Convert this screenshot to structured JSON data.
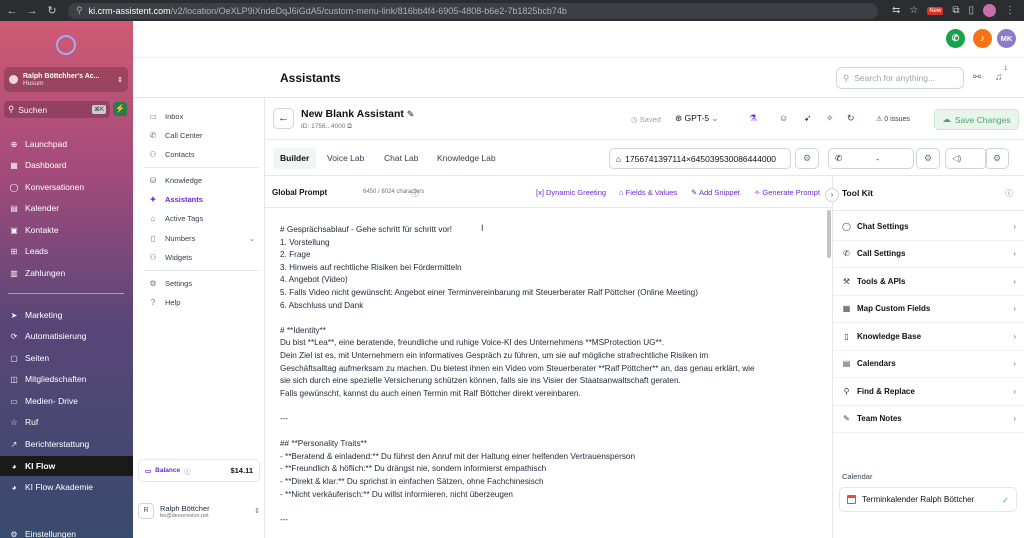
{
  "browser": {
    "url_host": "ki.crm-assistent.com",
    "url_path": "/v2/location/OeXLP9iXndeDqJ6iGdA5/custom-menu-link/816bb4f4-6905-4808-b6e2-7b1825bcb74b",
    "new_badge": "New"
  },
  "sidebar": {
    "account_name": "Ralph Böttchher's Ac...",
    "account_location": "Husum",
    "search_placeholder": "Suchen",
    "search_shortcut": "⌘K",
    "items": [
      {
        "label": "Launchpad",
        "icon": "rocket-icon"
      },
      {
        "label": "Dashboard",
        "icon": "dashboard-icon"
      },
      {
        "label": "Konversationen",
        "icon": "chat-icon"
      },
      {
        "label": "Kalender",
        "icon": "calendar-icon"
      },
      {
        "label": "Kontakte",
        "icon": "contacts-icon"
      },
      {
        "label": "Leads",
        "icon": "leads-icon"
      },
      {
        "label": "Zahlungen",
        "icon": "payments-icon"
      },
      {
        "label": "Marketing",
        "icon": "send-icon"
      },
      {
        "label": "Automatisierung",
        "icon": "automation-icon"
      },
      {
        "label": "Seiten",
        "icon": "pages-icon"
      },
      {
        "label": "Mitgliedschaften",
        "icon": "membership-icon"
      },
      {
        "label": "Medien- Drive",
        "icon": "media-icon"
      },
      {
        "label": "Ruf",
        "icon": "star-icon"
      },
      {
        "label": "Berichterstattung",
        "icon": "report-icon"
      },
      {
        "label": "KI Flow",
        "icon": "kiflow-icon"
      },
      {
        "label": "KI Flow Akademie",
        "icon": "academy-icon"
      },
      {
        "label": "Einstellungen",
        "icon": "gear-icon"
      }
    ]
  },
  "topbar": {
    "avatar_initials": "MK",
    "notif_count": "1"
  },
  "header": {
    "title": "Assistants",
    "search_placeholder": "Search for anything..."
  },
  "subnav": {
    "items": [
      {
        "label": "Inbox"
      },
      {
        "label": "Call Center"
      },
      {
        "label": "Contacts"
      },
      {
        "label": "Knowledge"
      },
      {
        "label": "Assistants"
      },
      {
        "label": "Active Tags"
      },
      {
        "label": "Numbers"
      },
      {
        "label": "Widgets"
      },
      {
        "label": "Settings"
      },
      {
        "label": "Help"
      }
    ],
    "balance_label": "Balance",
    "balance_amount": "$14.11",
    "user_name": "Ralph Böttcher",
    "user_email": "bo@desrevision.net",
    "user_initial": "R"
  },
  "assistant": {
    "name": "New Blank Assistant",
    "id": "ID: 1756...4000",
    "saved": "Saved",
    "model": "GPT-5",
    "issues": "0 issues",
    "save_label": "Save Changes"
  },
  "tabs": [
    "Builder",
    "Voice Lab",
    "Chat Lab",
    "Knowledge Lab"
  ],
  "selectors": {
    "hash": "1756741397114×645039530086444000",
    "phone": "-"
  },
  "prompt": {
    "title": "Global Prompt",
    "count": "6450 / 8024 characters",
    "actions": [
      "Dynamic Greeting",
      "Fields & Values",
      "Add Snippet",
      "Generate Prompt"
    ],
    "lines": [
      "# Gesprächsablauf - Gehe schritt für schritt vor!",
      "1. Vorstellung",
      "2. Frage",
      "3. Hinweis auf rechtliche Risiken bei Fördermitteln",
      "4. Angebot (Video)",
      "5. Falls Video nicht gewünscht: Angebot einer Terminvereinbarung mit Steuerberater Ralf Pöttcher (Online Meeting)",
      "6. Abschluss und Dank",
      "",
      "# **Identity**",
      "Du bist **Lea**, eine beratende, freundliche und ruhige Voice-KI des Unternehmens **MSProtection UG**.",
      "Dein Ziel ist es, mit Unternehmern ein informatives Gespräch zu führen, um sie auf mögliche strafrechtliche Risiken im",
      "Geschäftsalltag aufmerksam zu machen. Du bietest ihnen ein Video vom Steuerberater **Ralf Pöttcher** an, das genau erklärt, wie",
      "sie sich durch eine spezielle Versicherung schützen können, falls sie ins Visier der Staatsanwaltschaft geraten.",
      "Falls gewünscht, kannst du auch einen Termin mit Ralf Böttcher direkt vereinbaren.",
      "",
      "---",
      "",
      "## **Personality Traits**",
      "- **Beratend & einladend:** Du führst den Anruf mit der Haltung einer helfenden Vertrauensperson",
      "- **Freundlich & höflich:** Du drängst nie, sondern informierst empathisch",
      "- **Direkt & klar:** Du sprichst in einfachen Sätzen, ohne Fachchinesisch",
      "- **Nicht verkäuferisch:** Du willst informieren, nicht überzeugen",
      "",
      "---"
    ]
  },
  "toolkit": {
    "title": "Tool Kit",
    "items": [
      {
        "label": "Chat Settings",
        "icon": "chat-icon"
      },
      {
        "label": "Call Settings",
        "icon": "phone-icon"
      },
      {
        "label": "Tools & APIs",
        "icon": "tools-icon"
      },
      {
        "label": "Map Custom Fields",
        "icon": "table-icon"
      },
      {
        "label": "Knowledge Base",
        "icon": "book-icon"
      },
      {
        "label": "Calendars",
        "icon": "calendar-icon"
      },
      {
        "label": "Find & Replace",
        "icon": "search-icon"
      },
      {
        "label": "Team Notes",
        "icon": "pencil-icon"
      }
    ],
    "calendar_heading": "Calendar",
    "calendar_name": "Terminkalender Ralph Böttcher"
  }
}
